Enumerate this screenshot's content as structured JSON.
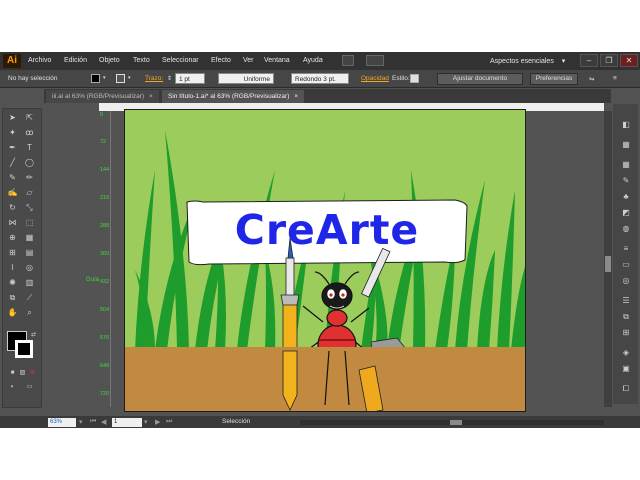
{
  "app": {
    "logo": "Ai"
  },
  "menu": [
    "Archivo",
    "Edición",
    "Objeto",
    "Texto",
    "Seleccionar",
    "Efecto",
    "Ver",
    "Ventana",
    "Ayuda"
  ],
  "workspace": {
    "label": "Aspectos esenciales",
    "arrow": "▾"
  },
  "window_controls": {
    "minimize": "–",
    "restore": "❐",
    "close": "✕"
  },
  "control_bar": {
    "selection_status": "No hay selección",
    "trazo_label": "Trazo:",
    "stroke_weight": "1 pt",
    "profile": "Uniforme",
    "brush": "Redondo 3 pt.",
    "opacity_label": "Opacidad",
    "style_label": "Estilo:",
    "doc_setup_button": "Ajustar documento",
    "prefs_button": "Preferencias"
  },
  "tabs": [
    {
      "label": "iii.ai al 63% (RGB/Previsualizar)",
      "close": "×"
    },
    {
      "label": "Sin título-1.ai* al 63% (RGB/Previsualizar)",
      "close": "×"
    }
  ],
  "rulers": {
    "vertical_ticks": [
      "0",
      "72",
      "144",
      "216",
      "288",
      "360",
      "432",
      "504",
      "576",
      "648",
      "720"
    ],
    "guide_label": "Guía"
  },
  "artwork": {
    "banner_text": "CreArte",
    "colors": {
      "background": "#9ccc5c",
      "grass": "#1e9d2c",
      "ground": "#c18a40",
      "banner_text": "#1f26e8",
      "ant_body": "#e03030",
      "ant_head": "#1a1a1a",
      "pencil": "#f2b21c",
      "hammer_handle": "#f0a81c"
    }
  },
  "status_bar": {
    "zoom": "63%",
    "page": "1",
    "selection_tool": "Selección"
  },
  "tools": [
    "selection-tool",
    "direct-selection-tool",
    "magic-wand-tool",
    "lasso-tool",
    "pen-tool",
    "type-tool",
    "line-tool",
    "ellipse-tool",
    "paintbrush-tool",
    "pencil-tool",
    "blob-brush-tool",
    "eraser-tool",
    "rotate-tool",
    "scale-tool",
    "width-tool",
    "free-transform-tool",
    "shape-builder-tool",
    "perspective-grid-tool",
    "mesh-tool",
    "gradient-tool",
    "eyedropper-tool",
    "blend-tool",
    "symbol-sprayer-tool",
    "column-graph-tool",
    "artboard-tool",
    "slice-tool",
    "hand-tool",
    "zoom-tool"
  ],
  "right_panel_icons": [
    "color-icon",
    "color-guide-icon",
    "swatches-icon",
    "brushes-icon",
    "symbols-icon",
    "graphic-styles-icon",
    "appearance-icon",
    "stroke-icon",
    "gradient-icon",
    "transparency-icon",
    "align-icon",
    "pathfinder-icon",
    "transform-icon",
    "layers-icon",
    "artboards-icon"
  ]
}
